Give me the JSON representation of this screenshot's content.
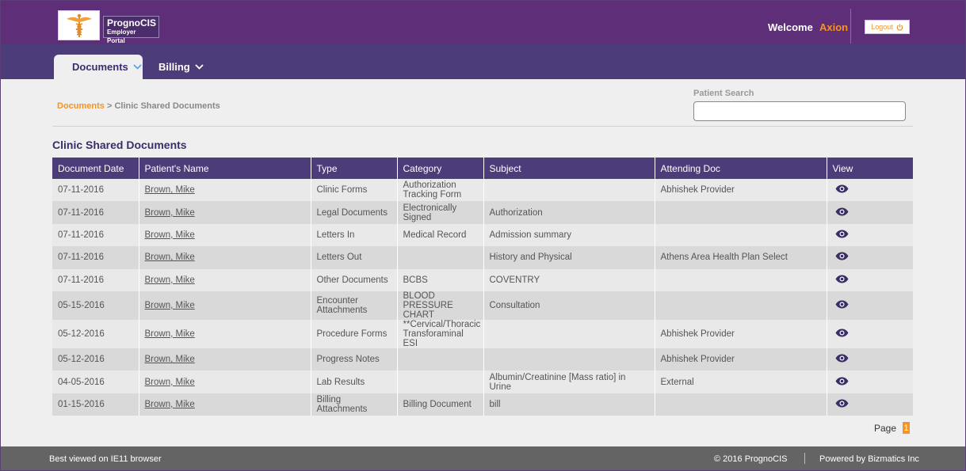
{
  "brand": {
    "name": "PrognoCIS",
    "subtitle": "Employer Portal"
  },
  "header": {
    "welcome": "Welcome",
    "user": "Axion",
    "logout": "Logout"
  },
  "nav": {
    "tabs": [
      {
        "label": "Documents"
      },
      {
        "label": "Billing"
      }
    ]
  },
  "breadcrumb": {
    "root": "Documents",
    "separator": ">",
    "current": "Clinic Shared Documents"
  },
  "patient_search": {
    "label": "Patient Search",
    "value": "",
    "placeholder": ""
  },
  "section_title": "Clinic Shared Documents",
  "table": {
    "columns": [
      "Document Date",
      "Patient's Name",
      "Type",
      "Category",
      "Subject",
      "Attending Doc",
      "View"
    ],
    "rows": [
      {
        "date": "07-11-2016",
        "patient": "Brown, Mike",
        "type": "Clinic Forms",
        "category": "Authorization Tracking Form",
        "subject": "",
        "doc": "Abhishek Provider"
      },
      {
        "date": "07-11-2016",
        "patient": "Brown, Mike",
        "type": "Legal Documents",
        "category": "Electronically Signed",
        "subject": "Authorization",
        "doc": ""
      },
      {
        "date": "07-11-2016",
        "patient": "Brown, Mike",
        "type": "Letters In",
        "category": "Medical Record",
        "subject": "Admission summary",
        "doc": ""
      },
      {
        "date": "07-11-2016",
        "patient": "Brown, Mike",
        "type": "Letters Out",
        "category": "",
        "subject": "History and Physical",
        "doc": "Athens Area Health Plan Select"
      },
      {
        "date": "07-11-2016",
        "patient": "Brown, Mike",
        "type": "Other Documents",
        "category": "BCBS",
        "subject": "COVENTRY",
        "doc": ""
      },
      {
        "date": "05-15-2016",
        "patient": "Brown, Mike",
        "type": "Encounter Attachments",
        "category": "BLOOD PRESSURE CHART",
        "subject": "Consultation",
        "doc": ""
      },
      {
        "date": "05-12-2016",
        "patient": "Brown, Mike",
        "type": "Procedure Forms",
        "category": "**Cervical/Thoracic Transforaminal ESI",
        "subject": "",
        "doc": "Abhishek Provider"
      },
      {
        "date": "05-12-2016",
        "patient": "Brown, Mike",
        "type": "Progress Notes",
        "category": "",
        "subject": "",
        "doc": "Abhishek Provider"
      },
      {
        "date": "04-05-2016",
        "patient": "Brown, Mike",
        "type": "Lab Results",
        "category": "",
        "subject": "Albumin/Creatinine [Mass ratio] in Urine",
        "doc": "External"
      },
      {
        "date": "01-15-2016",
        "patient": "Brown, Mike",
        "type": "Billing Attachments",
        "category": "Billing Document",
        "subject": "bill",
        "doc": ""
      }
    ]
  },
  "pager": {
    "label": "Page",
    "current": "1"
  },
  "footer": {
    "left": "Best viewed on IE11 browser",
    "copyright": "© 2016 PrognoCIS",
    "powered": "Powered by Bizmatics Inc"
  },
  "colors": {
    "header": "#5f2e79",
    "nav": "#4d3c7a",
    "accent": "#f39423",
    "footer": "#646464"
  },
  "icons": {
    "logo": "caduceus-icon",
    "logout": "power-icon",
    "view": "eye-icon",
    "dropdown": "chevron-down-icon"
  }
}
